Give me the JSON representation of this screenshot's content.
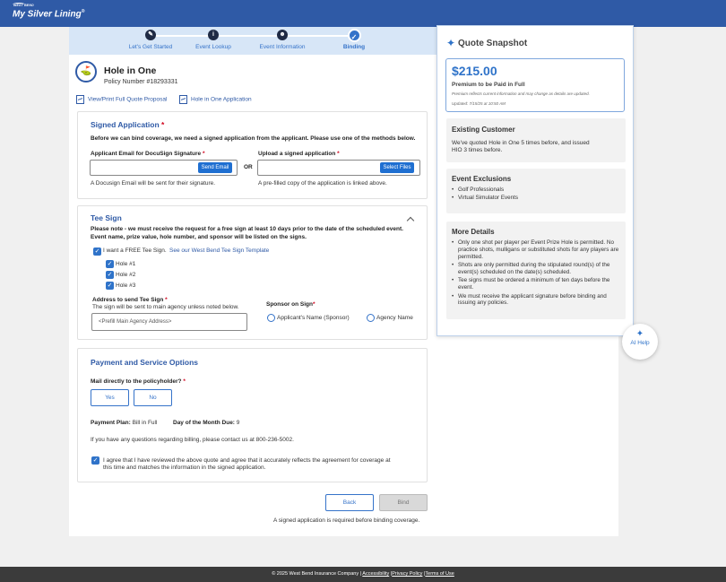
{
  "header": {
    "brand_small": "WEST BEND",
    "brand_main": "My Silver Lining",
    "brand_reg": "®"
  },
  "stepper": {
    "steps": [
      {
        "label": "Let's Get Started",
        "icon": "pencil-icon",
        "glyph": "✎"
      },
      {
        "label": "Event Lookup",
        "icon": "info-icon",
        "glyph": "i"
      },
      {
        "label": "Event Information",
        "icon": "person-icon",
        "glyph": "☻"
      },
      {
        "label": "Binding",
        "icon": "check-icon",
        "glyph": "✓"
      }
    ]
  },
  "product": {
    "title": "Hole in One",
    "policy": "Policy Number #18293331",
    "icon": "golf-flag-icon",
    "icon_glyph": "⛳"
  },
  "doc_links": {
    "quote": "View/Print Full Quote Proposal",
    "application": "Hole in One Application"
  },
  "signed": {
    "title": "Signed Application",
    "asterisk": "*",
    "intro": "Before we can bind coverage, we need a signed application from the applicant. Please use one of the methods below.",
    "email_label": "Applicant Email for DocuSign Signature",
    "email_value": "",
    "send_btn": "Send Email",
    "or": "OR",
    "upload_label": "Upload a signed application",
    "select_btn": "Select Files",
    "email_help": "A Docusign Email will be sent for their signature.",
    "upload_help": "A pre-filled copy of the application is linked above."
  },
  "tee": {
    "title": "Tee Sign",
    "note_1": "Please note - we must receive the request for a free sign at least 10 days prior to the date of the scheduled event.",
    "note_2": "Event name, prize value, hole number, and sponsor will be listed on the signs.",
    "want_label": "I want a FREE Tee Sign.",
    "template_link": "See our West Bend Tee Sign Template",
    "holes": [
      "Hole #1",
      "Hole #2",
      "Hole #3"
    ],
    "address_label": "Address to send Tee Sign",
    "address_help": "The sign will be sent to main agency unless noted below.",
    "address_value": "<Prefill Main Agency Address>",
    "sponsor_label": "Sponsor on Sign",
    "sponsor_opt_1": "Applicant's Name (Sponsor)",
    "sponsor_opt_2": "Agency Name"
  },
  "payment": {
    "title": "Payment and Service Options",
    "mail_label": "Mail directly to the policyholder?",
    "yes": "Yes",
    "no": "No",
    "plan_label": "Payment Plan:",
    "plan_value": "Bill in Full",
    "due_label": "Day of the Month Due:",
    "due_value": "9",
    "contact": "If you have any questions regarding billing, please contact us at 800-236-5002.",
    "agree_1": "I agree that I have reviewed the above quote and agree that it accurately reflects the agreement for coverage at",
    "agree_2": "this time and matches the information in the signed application."
  },
  "actions": {
    "back": "Back",
    "bind": "Bind",
    "note": "A signed application is required before binding coverage."
  },
  "snapshot": {
    "title": "Quote Snapshot",
    "amount": "$215.00",
    "sub": "Premium to be Paid in Full",
    "note": "Premium reflects current information and may change as details are updated.",
    "updated": "Updated: 7/15/25 at 10:50 AM",
    "existing_title": "Existing Customer",
    "existing_1": "We've quoted Hole in One 5 times before, and issued",
    "existing_2": "HIO 3 times before.",
    "exclusions_title": "Event Exclusions",
    "exclusions": [
      "Golf Professionals",
      "Virtual Simulator Events"
    ],
    "details_title": "More Details",
    "details": [
      "Only one shot per player per Event Prize Hole is permitted. No practice shots, mulligans or substituted shots for any players are permitted.",
      "Shots are only permitted during the stipulated round(s) of the event(s) scheduled on the date(s) scheduled.",
      "Tee signs must be ordered a minimum of ten days before the event.",
      "We must receive the applicant signature before binding and issuing any policies."
    ]
  },
  "ai_help": {
    "label": "AI Help"
  },
  "footer": {
    "copyright": "© 2025 West Bend Insurance Company |",
    "accessibility": "Accessibility",
    "sep": "|",
    "privacy": "Privacy Policy",
    "terms": "Terms of Use"
  },
  "colors": {
    "brand_blue": "#2f5aa6",
    "accent_blue": "#3573c9",
    "required_red": "#d0021b"
  }
}
